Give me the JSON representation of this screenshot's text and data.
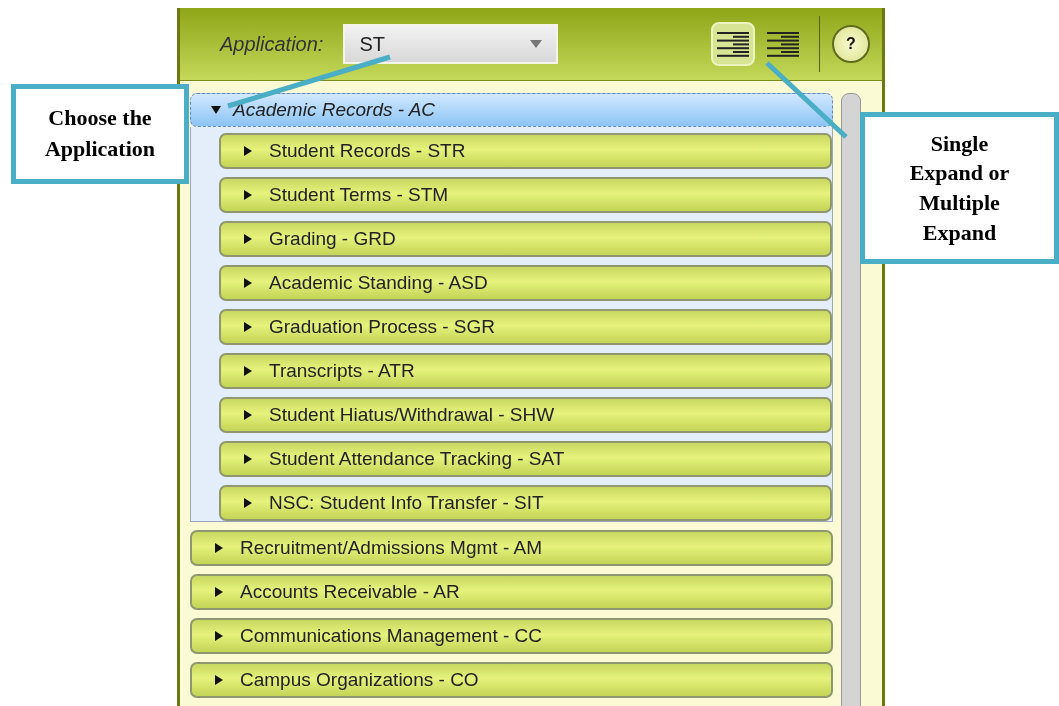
{
  "application": {
    "label": "Application:",
    "value": "ST"
  },
  "expand_modes": [
    {
      "kind": "single",
      "selected": true
    },
    {
      "kind": "multiple",
      "selected": false
    }
  ],
  "help": {
    "label": "?"
  },
  "tree": [
    {
      "label": "Academic Records - AC",
      "expanded": true,
      "selected": true,
      "children": [
        {
          "label": "Student Records - STR",
          "expanded": false,
          "selected": false
        },
        {
          "label": "Student Terms - STM",
          "expanded": false,
          "selected": false
        },
        {
          "label": "Grading  - GRD",
          "expanded": false,
          "selected": false
        },
        {
          "label": "Academic Standing - ASD",
          "expanded": false,
          "selected": false
        },
        {
          "label": "Graduation Process - SGR",
          "expanded": false,
          "selected": false
        },
        {
          "label": "Transcripts - ATR",
          "expanded": false,
          "selected": false
        },
        {
          "label": "Student Hiatus/Withdrawal - SHW",
          "expanded": false,
          "selected": false
        },
        {
          "label": "Student Attendance Tracking - SAT",
          "expanded": false,
          "selected": false
        },
        {
          "label": "NSC: Student Info Transfer - SIT",
          "expanded": false,
          "selected": false
        }
      ]
    },
    {
      "label": "Recruitment/Admissions Mgmt - AM",
      "expanded": false,
      "selected": false
    },
    {
      "label": "Accounts Receivable - AR",
      "expanded": false,
      "selected": false
    },
    {
      "label": "Communications Management - CC",
      "expanded": false,
      "selected": false
    },
    {
      "label": "Campus Organizations - CO",
      "expanded": false,
      "selected": false
    }
  ],
  "callouts": [
    {
      "kind": "left",
      "text": "Choose the Application"
    },
    {
      "kind": "right",
      "text": "Single Expand or Multiple Expand"
    }
  ]
}
